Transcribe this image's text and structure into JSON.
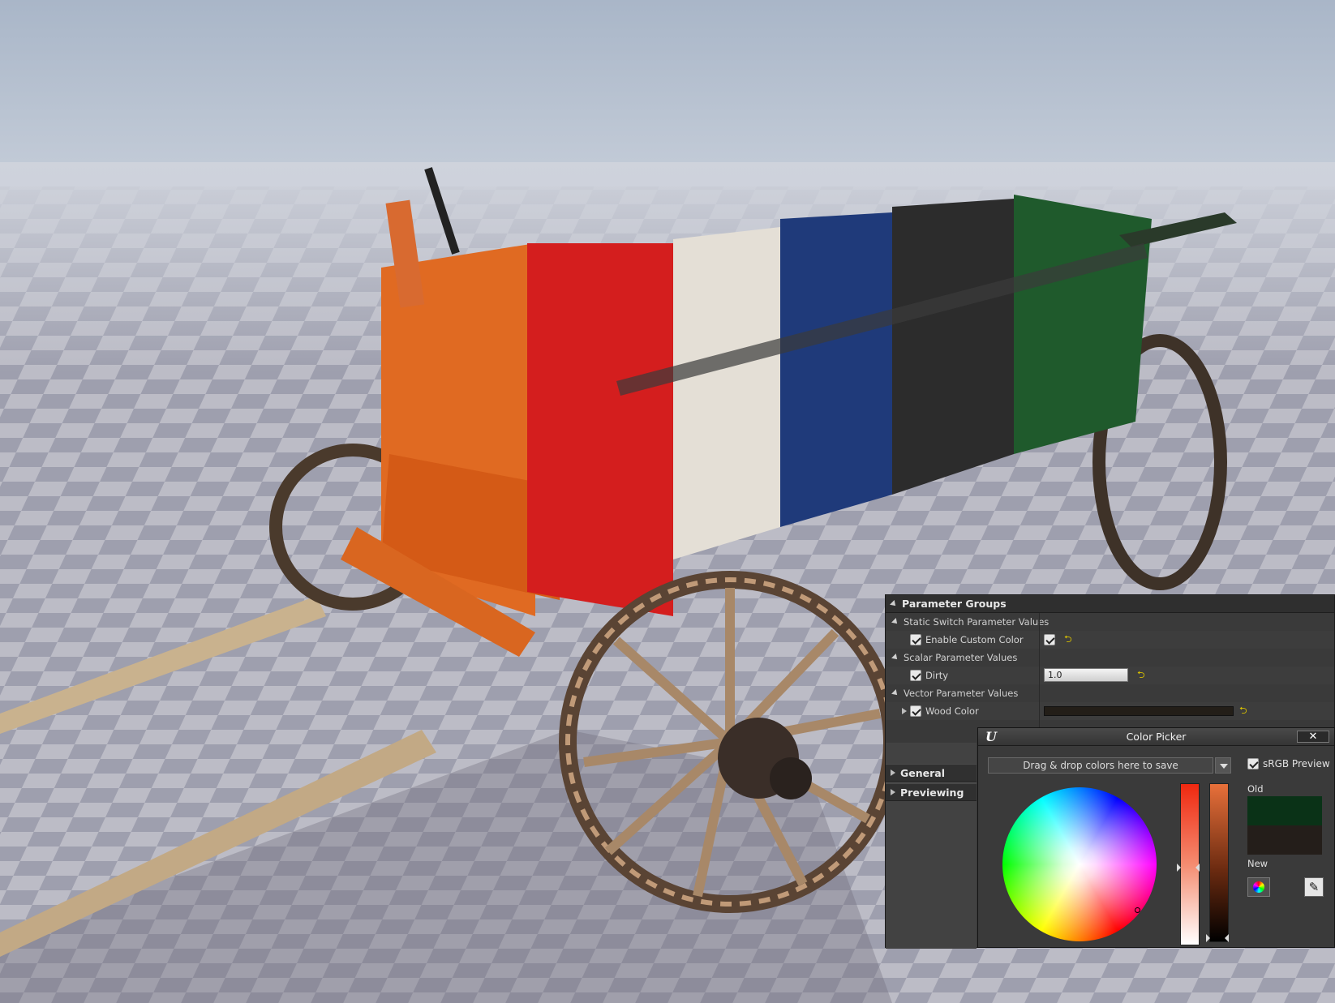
{
  "details_panel": {
    "header": "Parameter Groups",
    "categories": {
      "static_switch": "Static Switch Parameter Values",
      "scalar": "Scalar Parameter Values",
      "vector": "Vector Parameter Values"
    },
    "params": {
      "enable_custom_color": {
        "label": "Enable Custom Color",
        "checked": true
      },
      "dirty": {
        "label": "Dirty",
        "value": "1.0"
      },
      "wood_color": {
        "label": "Wood Color",
        "color": "#231e18"
      }
    },
    "sections": {
      "general": "General",
      "previewing": "Previewing"
    },
    "reset_glyph": "⮌"
  },
  "color_picker": {
    "title": "Color Picker",
    "close_label": "✕",
    "dropzone_text": "Drag & drop colors here to save",
    "srgb_label": "sRGB Preview",
    "srgb_checked": true,
    "old_label": "Old",
    "new_label": "New",
    "old_color": "#0a3217",
    "new_color": "#241e1a"
  },
  "viewport": {
    "description_colors": [
      "#e45a14",
      "#e21c1c",
      "#e8e4dc",
      "#1e3a78",
      "#262626",
      "#1e5a2a"
    ]
  }
}
